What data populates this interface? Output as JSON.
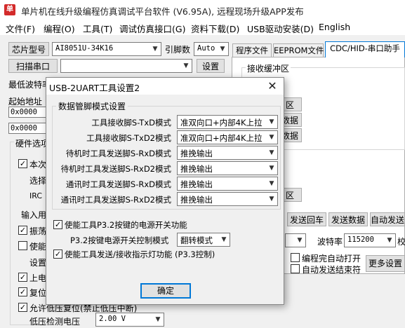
{
  "window": {
    "icon_text": "单",
    "title": "单片机在线升级编程仿真调试平台软件 (V6.95A), 远程现场升级APP发布"
  },
  "menu": [
    "文件(F)",
    "编程(O)",
    "工具(T)",
    "调试仿真接口(G)",
    "资料下载(D)",
    "USB驱动安装(D)",
    "English"
  ],
  "left_panel": {
    "chip_model_label": "芯片型号",
    "chip_model_value": "AI8051U-34K16",
    "pin_count_label": "引脚数",
    "pin_count_value": "Auto",
    "scan_port_label": "扫描串口",
    "port_value": "",
    "settings_button": "设置",
    "min_baud_label": "最低波特率",
    "start_addr_label": "起始地址",
    "addr1": "0x0000",
    "addr2": "0x0000",
    "hw_options_label": "硬件选项",
    "opt_text_1": "本次",
    "opt_text_2": "选择",
    "opt_text_3": "IRC",
    "input_label": "输入用",
    "opt_text_4": "振荡",
    "opt_text_5": "使能",
    "opt_text_6": "设置",
    "opt_text_7": "上电",
    "opt_text_8": "复位",
    "opt_text_9": "允许低压复位(禁止低压中断)",
    "low_voltage_label": "低压检测电压",
    "low_voltage_value": "2.00 V"
  },
  "right_panel": {
    "tabs": [
      "程序文件",
      "EEPROM文件",
      "CDC/HID-串口助手"
    ],
    "receive_buffer_label": "接收缓冲区",
    "btn_clear_1": "区",
    "btn_data_1": "数据",
    "btn_data_2": "数据",
    "btn_clear_2": "区",
    "send_loopback": "发送回车",
    "send_data": "发送数据",
    "auto_send": "自动发送",
    "baud_label": "波特率",
    "baud_value": "115200",
    "baud_suffix": "校",
    "auto_open_after_prog": "编程完自动打开",
    "auto_send_end": "自动发送结束符",
    "more_settings": "更多设置"
  },
  "dialog": {
    "title": "USB-2UART工具设置2",
    "close_glyph": "✕",
    "group_title": "数据管脚模式设置",
    "rows": [
      {
        "label": "工具接收脚S-TxD模式",
        "value": "准双向口+内部4K上拉"
      },
      {
        "label": "工具接收脚S-TxD2模式",
        "value": "准双向口+内部4K上拉"
      },
      {
        "label": "待机时工具发送脚S-RxD模式",
        "value": "推挽输出"
      },
      {
        "label": "待机时工具发送脚S-RxD2模式",
        "value": "推挽输出"
      },
      {
        "label": "通讯时工具发送脚S-RxD模式",
        "value": "推挽输出"
      },
      {
        "label": "通讯时工具发送脚S-RxD2模式",
        "value": "推挽输出"
      }
    ],
    "enable_p32_label": "使能工具P3.2按键的电源开关功能",
    "p32_mode_label": "P3.2按键电源开关控制模式",
    "p32_mode_value": "翻转模式",
    "enable_p33_label": "使能工具发送/接收指示灯功能 (P3.3控制)",
    "ok_button": "确定"
  },
  "colors": {
    "app_icon": "#d32b2b",
    "focus_border": "#0078d7"
  }
}
